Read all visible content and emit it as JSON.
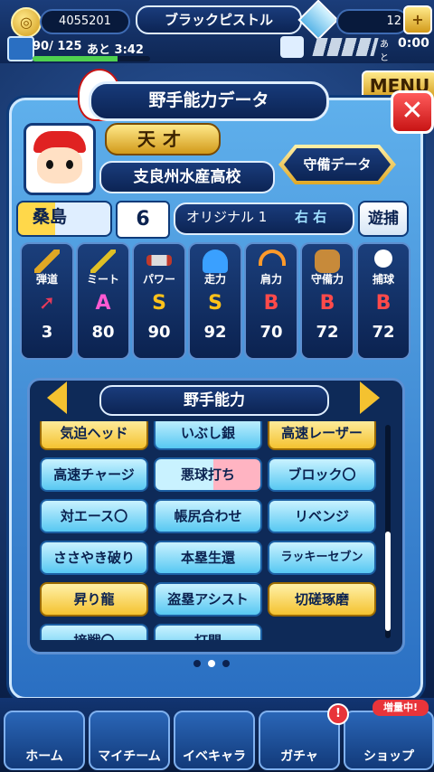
{
  "topbar": {
    "coins": "4055201",
    "team_name": "ブラックピストル",
    "gems": "12",
    "stamina": "90/ 125",
    "stamina_timer": "あと 3:42",
    "other_timer_prefix": "あと",
    "other_timer": "0:00"
  },
  "background": {
    "menu_label": "MENU"
  },
  "panel": {
    "title": "野手能力データ",
    "close_label": "✕",
    "player": {
      "rank_label": "天才",
      "school": "支良州水産高校",
      "defense_button": "守備データ",
      "name": "桑島",
      "number": "6",
      "type_label": "オリジナル 1",
      "handedness": "右 右",
      "position": "遊捕"
    },
    "stats": [
      {
        "label": "弾道",
        "grade": "",
        "value": "3",
        "grade_color": "#e83a5a"
      },
      {
        "label": "ミート",
        "grade": "A",
        "value": "80",
        "grade_color": "#ff5ad2"
      },
      {
        "label": "パワー",
        "grade": "S",
        "value": "90",
        "grade_color": "#ffc21a"
      },
      {
        "label": "走力",
        "grade": "S",
        "value": "92",
        "grade_color": "#ffc21a"
      },
      {
        "label": "肩力",
        "grade": "B",
        "value": "70",
        "grade_color": "#ff4a4a"
      },
      {
        "label": "守備力",
        "grade": "B",
        "value": "72",
        "grade_color": "#ff4a4a"
      },
      {
        "label": "捕球",
        "grade": "B",
        "value": "72",
        "grade_color": "#ff4a4a"
      }
    ],
    "skills_section": {
      "title": "野手能力",
      "skills": [
        {
          "label": "気迫ヘッド",
          "style": "gold"
        },
        {
          "label": "いぶし銀",
          "style": "blue"
        },
        {
          "label": "高速レーザー",
          "style": "gold"
        },
        {
          "label": "高速チャージ",
          "style": "blue"
        },
        {
          "label": "悪球打ち",
          "style": "pink"
        },
        {
          "label": "ブロック〇",
          "style": "blue"
        },
        {
          "label": "対エース〇",
          "style": "blue"
        },
        {
          "label": "帳尻合わせ",
          "style": "blue"
        },
        {
          "label": "リベンジ",
          "style": "blue"
        },
        {
          "label": "ささやき破り",
          "style": "blue"
        },
        {
          "label": "本塁生還",
          "style": "blue"
        },
        {
          "label": "ラッキーセブン",
          "style": "blue"
        },
        {
          "label": "昇り龍",
          "style": "gold"
        },
        {
          "label": "盗塁アシスト",
          "style": "blue"
        },
        {
          "label": "切磋琢磨",
          "style": "gold"
        },
        {
          "label": "接戦〇",
          "style": "blue"
        },
        {
          "label": "打開",
          "style": "blue"
        }
      ]
    },
    "page_dots": [
      "inactive",
      "active",
      "inactive"
    ]
  },
  "bottom_nav": [
    {
      "label": "ホーム"
    },
    {
      "label": "マイチーム"
    },
    {
      "label": "イベキャラ"
    },
    {
      "label": "ガチャ"
    },
    {
      "label": "ショップ"
    }
  ],
  "bottom_badge": "増量中!"
}
